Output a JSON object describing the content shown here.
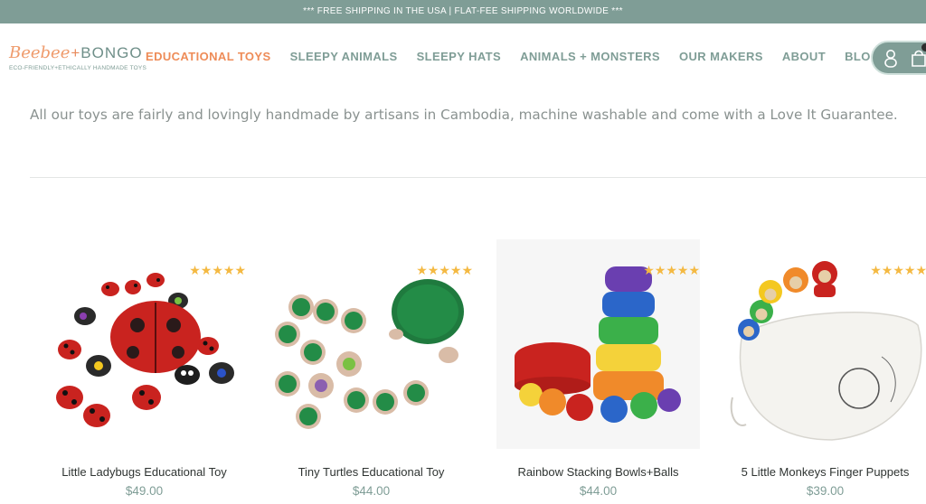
{
  "banner": {
    "text": "*** FREE SHIPPING IN THE USA | FLAT-FEE SHIPPING WORLDWIDE ***"
  },
  "logo": {
    "part1": "Beebee",
    "plus": "+",
    "part2": "BONGO",
    "tagline": "ECO-FRIENDLY+ETHICALLY HANDMADE TOYS"
  },
  "nav": {
    "items": [
      {
        "label": "EDUCATIONAL TOYS",
        "active": true
      },
      {
        "label": "SLEEPY ANIMALS"
      },
      {
        "label": "SLEEPY HATS"
      },
      {
        "label": "ANIMALS + MONSTERS"
      },
      {
        "label": "OUR MAKERS"
      },
      {
        "label": "ABOUT"
      },
      {
        "label": "BLOG"
      }
    ]
  },
  "header_icons": {
    "account": "user-icon",
    "cart": "shopping-bag-icon"
  },
  "intro": {
    "text": "All our toys are fairly and lovingly handmade by artisans in Cambodia, machine washable and come with a Love It Guarantee."
  },
  "products": [
    {
      "name": "Little Ladybugs Educational Toy",
      "price": "$49.00",
      "rating": 5
    },
    {
      "name": "Tiny Turtles Educational Toy",
      "price": "$44.00",
      "rating": 5
    },
    {
      "name": "Rainbow Stacking Bowls+Balls",
      "price": "$44.00",
      "rating": 5
    },
    {
      "name": "5 Little Monkeys Finger Puppets",
      "price": "$39.00",
      "rating": 5
    }
  ],
  "colors": {
    "accent": "#ee8c58",
    "brand": "#7f9d96",
    "star": "#f4b942"
  }
}
